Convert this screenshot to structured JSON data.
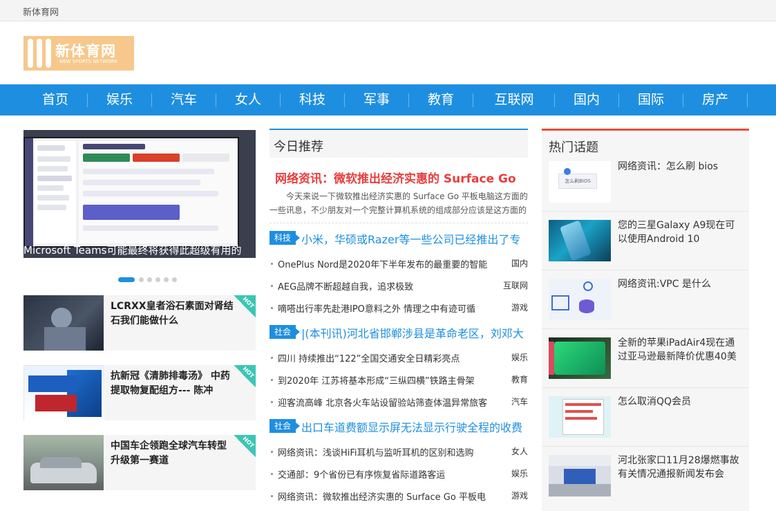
{
  "topbar": {
    "site_name": "新体育网"
  },
  "logo": {
    "name": "新体育网",
    "subtitle": "NEW SPORTS NETWORK"
  },
  "nav": [
    "首页",
    "娱乐",
    "汽车",
    "女人",
    "科技",
    "军事",
    "教育",
    "互联网",
    "国内",
    "国际",
    "房产"
  ],
  "slider": {
    "caption": "Microsoft Teams可能最终将获得此超级有用的",
    "dots_count": 6,
    "active_dot": 0
  },
  "hot_cards": [
    {
      "title": "LCRXX皇者浴石素面对肾结石我们能做什么",
      "badge": "HOT"
    },
    {
      "title": "抗新冠《清肺排毒汤》 中药提取物复配组方--- 陈冲",
      "badge": "HOT"
    },
    {
      "title": "中国车企领跑全球汽车转型 升级第一赛道",
      "badge": "HOT"
    }
  ],
  "today": {
    "heading": "今日推荐",
    "featured_title": "网络资讯：微软推出经济实惠的 Surface Go",
    "featured_desc": "今天来说一下微软推出经济实惠的 Surface Go 平板电脑这方面的一些讯息，不少朋友对一个完整计算机系统的组成部分应该是这方面的",
    "groups": [
      {
        "tag": "科技",
        "headline": "小米，华硕或Razer等一些公司已经推出了专",
        "items": [
          {
            "title": "OnePlus Nord是2020年下半年发布的最重要的智能",
            "cat": "国内"
          },
          {
            "title": "AEG品牌不断超越自我，追求极致",
            "cat": "互联网"
          },
          {
            "title": "嘀嗒出行率先赴港IPO意料之外 情理之中有迹可循",
            "cat": "游戏"
          }
        ]
      },
      {
        "tag": "社会",
        "headline": "|(本刊讯)河北省邯郸涉县是革命老区，刘邓大",
        "items": [
          {
            "title": "四川 持续推出“122”全国交通安全日精彩亮点",
            "cat": "娱乐"
          },
          {
            "title": "到2020年 江苏将基本形成“三纵四横”铁路主骨架",
            "cat": "教育"
          },
          {
            "title": "迎客流高峰 北京各火车站设留验站筛查体温异常旅客",
            "cat": "汽车"
          }
        ]
      },
      {
        "tag": "社会",
        "headline": "出口车道费额显示屏无法显示行驶全程的收费",
        "items": [
          {
            "title": "网络资讯：浅谈HiFi耳机与监听耳机的区别和选购",
            "cat": "女人"
          },
          {
            "title": "交通部：9个省份已有序恢复省际道路客运",
            "cat": "娱乐"
          },
          {
            "title": "网络资讯：微软推出经济实惠的 Surface Go 平板电",
            "cat": "游戏"
          }
        ]
      }
    ]
  },
  "hot_topics": {
    "heading": "热门话题",
    "items": [
      {
        "title": "网络资讯：怎么刷 bios",
        "thumb_label": "怎么刷BIOS"
      },
      {
        "title": "您的三星Galaxy A9现在可以使用Android 10"
      },
      {
        "title": "网络资讯:VPC 是什么"
      },
      {
        "title": "全新的苹果iPadAir4现在通过亚马逊最新降价优惠40美"
      },
      {
        "title": "怎么取消QQ会员"
      },
      {
        "title": "河北张家口11月28爆燃事故有关情况通报新闻发布会"
      }
    ]
  },
  "colors": {
    "primary": "#1e8fe0",
    "featured": "#e83d3d",
    "hot_accent": "#e84c3d",
    "hot_badge": "#3bc6b4",
    "logo_bg": "#f6c88b"
  }
}
